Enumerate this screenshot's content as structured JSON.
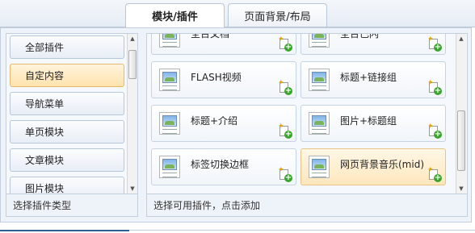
{
  "tabs": [
    {
      "label": "模块/插件",
      "active": true
    },
    {
      "label": "页面背景/布局",
      "active": false
    }
  ],
  "categories": {
    "items": [
      {
        "label": "全部插件",
        "selected": false
      },
      {
        "label": "自定内容",
        "selected": true
      },
      {
        "label": "导航菜单",
        "selected": false
      },
      {
        "label": "单页模块",
        "selected": false
      },
      {
        "label": "文章模块",
        "selected": false
      },
      {
        "label": "图片模块",
        "selected": false
      }
    ],
    "footer": "选择插件类型"
  },
  "plugins": {
    "items": [
      {
        "label": "全台文档",
        "icon": "image-thumbnail-icon"
      },
      {
        "label": "全台己闪",
        "icon": "image-thumbnail-icon"
      },
      {
        "label": "FLASH视频",
        "icon": "image-thumbnail-icon"
      },
      {
        "label": "标题+链接组",
        "icon": "image-thumbnail-icon"
      },
      {
        "label": "标题+介绍",
        "icon": "image-thumbnail-icon"
      },
      {
        "label": "图片+标题组",
        "icon": "image-thumbnail-icon"
      },
      {
        "label": "标签切换边框",
        "icon": "image-thumbnail-icon"
      },
      {
        "label": "网页背景音乐(mid)",
        "icon": "image-thumbnail-icon",
        "highlighted": true
      }
    ],
    "footer": "选择可用插件，点击添加"
  },
  "colors": {
    "selected_bg": "#ffe2ad",
    "panel_bg": "#eef3f9",
    "border": "#c3cfdd",
    "add_green": "#3aa52c"
  }
}
